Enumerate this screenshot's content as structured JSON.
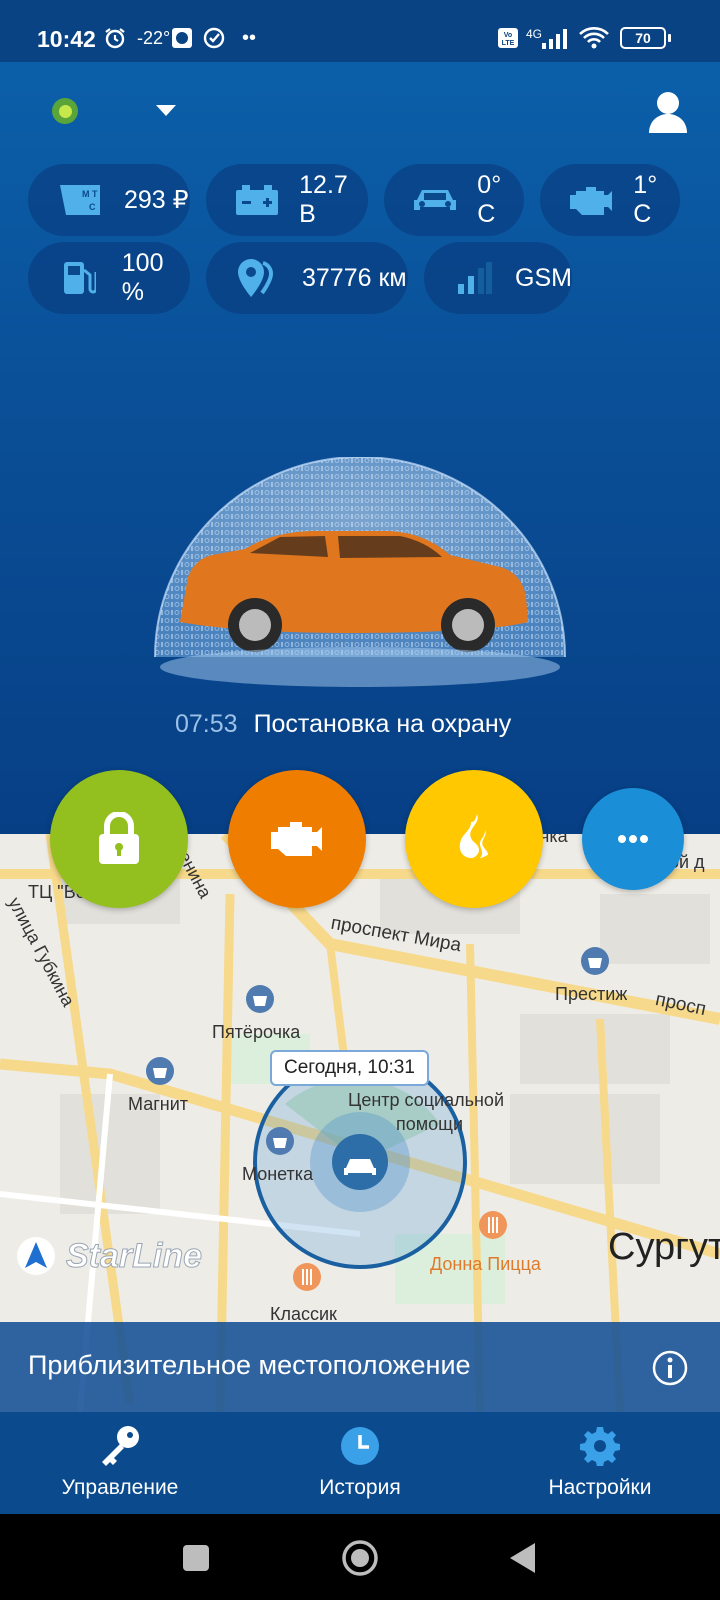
{
  "status_bar": {
    "time": "10:42",
    "temperature": "-22°",
    "network": "4G",
    "battery": "70"
  },
  "chips": [
    {
      "icon": "mts-operator-icon",
      "value": "293 ₽"
    },
    {
      "icon": "battery-icon",
      "value": "12.7 В"
    },
    {
      "icon": "car-icon",
      "value": "0° C"
    },
    {
      "icon": "engine-icon",
      "value": "1° C"
    },
    {
      "icon": "fuel-pump-icon",
      "value": "100 %"
    },
    {
      "icon": "location-pin-icon",
      "value": "37776 км"
    },
    {
      "icon": "signal-icon",
      "value": "GSM"
    }
  ],
  "event": {
    "time": "07:53",
    "text": "Постановка на охрану"
  },
  "action_buttons": [
    {
      "name": "lock-button",
      "color": "#93c01f"
    },
    {
      "name": "engine-start-button",
      "color": "#ef7d00"
    },
    {
      "name": "heater-button",
      "color": "#ffc800"
    },
    {
      "name": "more-button",
      "color": "#1a8fd8"
    }
  ],
  "map": {
    "labels": {
      "voskhod": "ТЦ \"Восход",
      "gubkina": "улица Губкина",
      "lenina": "енина",
      "mira": "проспект Мира",
      "prestizh": "Престиж",
      "prosp": "просп",
      "pyaterochka": "Пятёрочка",
      "magnit": "Магнит",
      "center": "Центр социальной",
      "center2": "помощи",
      "monetka": "Монетка",
      "donna": "Донна Пицца",
      "klassik": "Классик",
      "surgut": "Сургут",
      "ochka": "чка",
      "snoy": "сной д"
    },
    "callout": "Сегодня, 10:31",
    "logo": "StarLine"
  },
  "approx": {
    "text": "Приблизительное местоположение"
  },
  "nav": [
    {
      "label": "Управление"
    },
    {
      "label": "История"
    },
    {
      "label": "Настройки"
    }
  ]
}
